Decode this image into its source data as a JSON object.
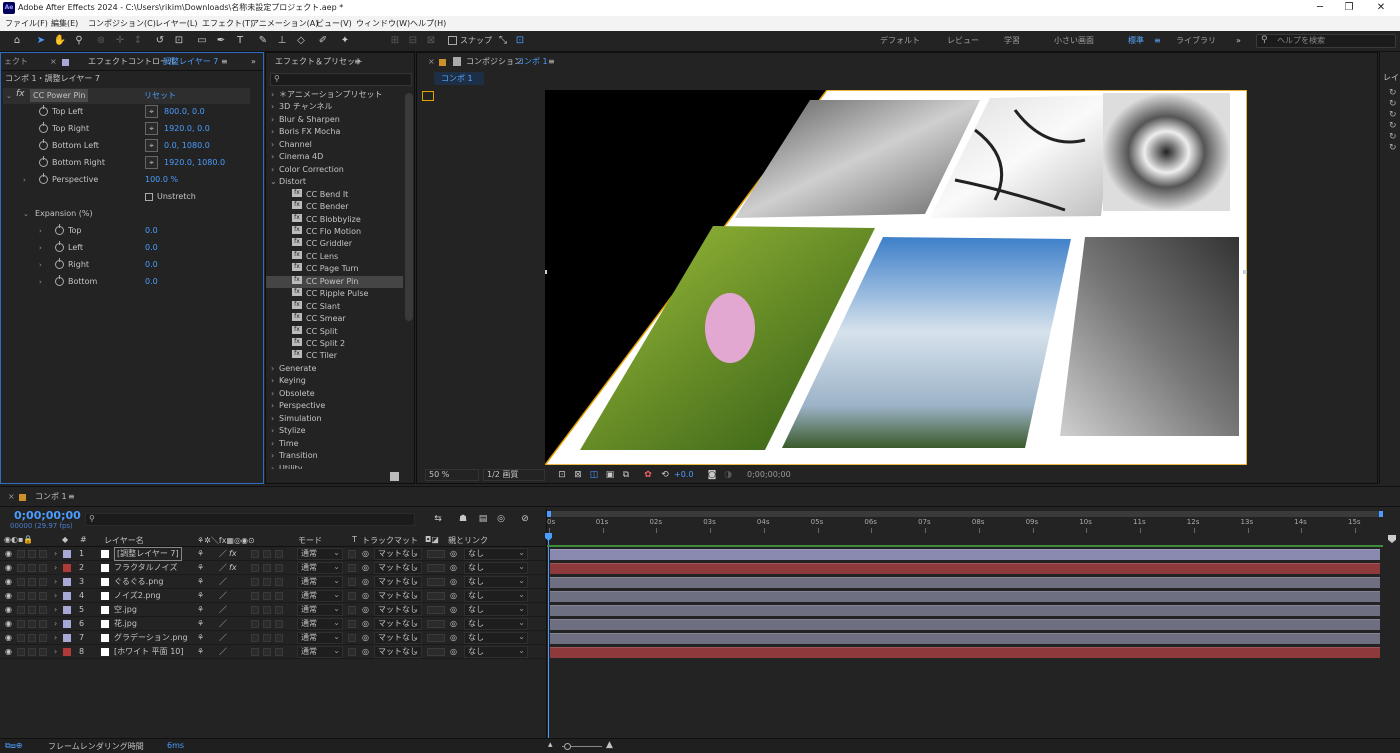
{
  "app": {
    "title": "Adobe After Effects 2024 - C:\\Users\\rikim\\Downloads\\名称未設定プロジェクト.aep *",
    "icon": "Ae"
  },
  "menu": [
    "ファイル(F)",
    "編集(E)",
    "コンポジション(C)",
    "レイヤー(L)",
    "エフェクト(T)",
    "アニメーション(A)",
    "ビュー(V)",
    "ウィンドウ(W)",
    "ヘルプ(H)"
  ],
  "toolbar": {
    "snap_label": "スナップ",
    "workspaces": [
      "デフォルト",
      "レビュー",
      "学習",
      "小さい画面",
      "標準",
      "ライブラリ"
    ],
    "active_workspace": "標準",
    "help_placeholder": "ヘルプを検索"
  },
  "effect_controls": {
    "tab_left": "ェクト",
    "tab_label": "エフェクトコントロール",
    "tab_layer": "調整レイヤー 7",
    "breadcrumb": "コンポ 1・調整レイヤー 7",
    "effect_name": "CC Power Pin",
    "reset_label": "リセット",
    "fx_label": "fx",
    "params": [
      {
        "name": "Top Left",
        "value": "800.0, 0.0"
      },
      {
        "name": "Top Right",
        "value": "1920.0, 0.0"
      },
      {
        "name": "Bottom Left",
        "value": "0.0, 1080.0"
      },
      {
        "name": "Bottom Right",
        "value": "1920.0, 1080.0"
      },
      {
        "name": "Perspective",
        "value": "100.0 %"
      }
    ],
    "unstretch_label": "Unstretch",
    "expansion_label": "Expansion (%)",
    "expansion": [
      {
        "name": "Top",
        "value": "0.0"
      },
      {
        "name": "Left",
        "value": "0.0"
      },
      {
        "name": "Right",
        "value": "0.0"
      },
      {
        "name": "Bottom",
        "value": "0.0"
      }
    ]
  },
  "effects_presets": {
    "tab_label": "エフェクト＆プリセット",
    "search_placeholder": "",
    "categories_before": [
      "＊アニメーションプリセット",
      "3D チャンネル",
      "Blur & Sharpen",
      "Boris FX Mocha",
      "Channel",
      "Cinema 4D",
      "Color Correction"
    ],
    "open_category": "Distort",
    "distort_items": [
      "CC Bend It",
      "CC Bender",
      "CC Blobbylize",
      "CC Flo Motion",
      "CC Griddler",
      "CC Lens",
      "CC Page Turn",
      "CC Power Pin",
      "CC Ripple Pulse",
      "CC Slant",
      "CC Smear",
      "CC Split",
      "CC Split 2",
      "CC Tiler"
    ],
    "selected_item": "CC Power Pin",
    "categories_after": [
      "Generate",
      "Keying",
      "Obsolete",
      "Perspective",
      "Simulation",
      "Stylize",
      "Time",
      "Transition",
      "Utility"
    ]
  },
  "composition": {
    "tab_prefix": "コンポジション",
    "tab_comp": "コンポ 1",
    "subtab": "コンポ 1",
    "zoom": "50 %",
    "resolution": "1/2 画質",
    "exposure": "+0.0",
    "timecode": "0;00;00;00"
  },
  "right_strip": [
    "レイ"
  ],
  "timeline": {
    "tab_label": "コンポ 1",
    "timecode": "0;00;00;00",
    "frame_info": "00000 (29.97 fps)",
    "search_placeholder": "",
    "headers": {
      "layer_name": "レイヤー名",
      "mode": "モード",
      "t": "T",
      "track_matte": "トラックマット",
      "parent": "親とリンク"
    },
    "ruler": [
      "0s",
      "01s",
      "02s",
      "03s",
      "04s",
      "05s",
      "06s",
      "07s",
      "08s",
      "09s",
      "10s",
      "11s",
      "12s",
      "13s",
      "14s",
      "15s"
    ],
    "layers": [
      {
        "num": "1",
        "name": "[調整レイヤー 7]",
        "color": "#a7a7d8",
        "fx": "fx",
        "mode": "通常",
        "matte": "マットなし",
        "parent": "なし",
        "bar": "#8a8ab0"
      },
      {
        "num": "2",
        "name": "フラクタルノイズ",
        "color": "#b03a3a",
        "fx": "fx",
        "mode": "通常",
        "matte": "マットなし",
        "parent": "なし",
        "bar": "#8e3a3c"
      },
      {
        "num": "3",
        "name": "ぐるぐる.png",
        "color": "#a7a7d8",
        "fx": "",
        "mode": "通常",
        "matte": "マットなし",
        "parent": "なし",
        "bar": "#6f6f82"
      },
      {
        "num": "4",
        "name": "ノイズ2.png",
        "color": "#a7a7d8",
        "fx": "",
        "mode": "通常",
        "matte": "マットなし",
        "parent": "なし",
        "bar": "#6f6f82"
      },
      {
        "num": "5",
        "name": "空.jpg",
        "color": "#a7a7d8",
        "fx": "",
        "mode": "通常",
        "matte": "マットなし",
        "parent": "なし",
        "bar": "#6f6f82"
      },
      {
        "num": "6",
        "name": "花.jpg",
        "color": "#a7a7d8",
        "fx": "",
        "mode": "通常",
        "matte": "マットなし",
        "parent": "なし",
        "bar": "#6f6f82"
      },
      {
        "num": "7",
        "name": "グラデーション.png",
        "color": "#a7a7d8",
        "fx": "",
        "mode": "通常",
        "matte": "マットなし",
        "parent": "なし",
        "bar": "#6f6f82"
      },
      {
        "num": "8",
        "name": "[ホワイト 平面 10]",
        "color": "#b03a3a",
        "fx": "",
        "mode": "通常",
        "matte": "マットなし",
        "parent": "なし",
        "bar": "#8e3a3c"
      }
    ],
    "render_label": "フレームレンダリング時間",
    "render_time": "6ms"
  },
  "colors": {
    "accent": "#4a9dff",
    "comp_border": "#e0a000",
    "bg": "#232323"
  }
}
